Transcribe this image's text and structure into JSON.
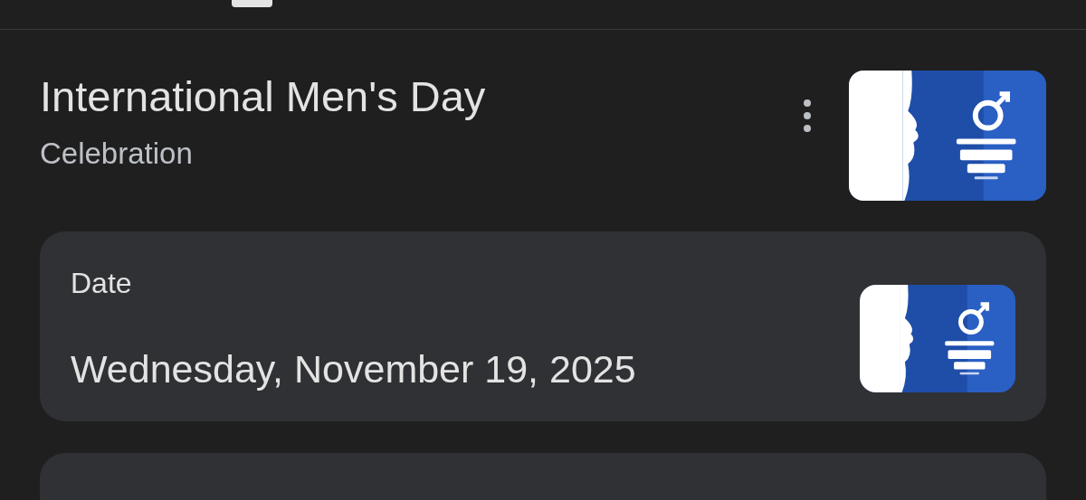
{
  "entity": {
    "title": "International Men's Day",
    "subtitle": "Celebration"
  },
  "date_card": {
    "label": "Date",
    "value": "Wednesday, November 19, 2025"
  }
}
